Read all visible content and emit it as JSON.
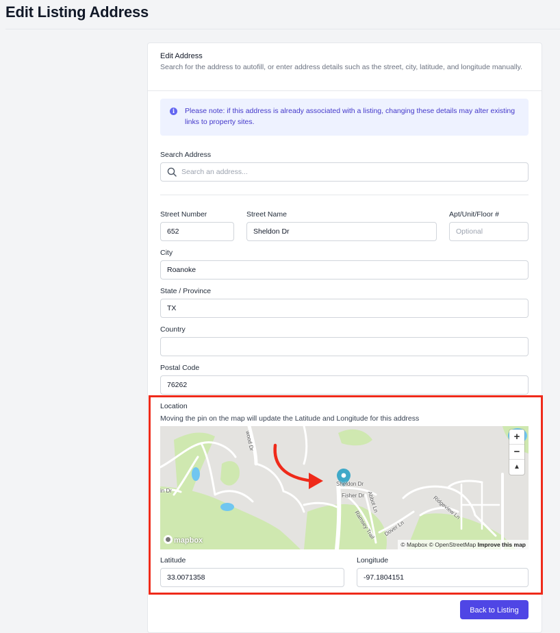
{
  "page": {
    "title": "Edit Listing Address"
  },
  "card": {
    "title": "Edit Address",
    "description": "Search for the address to autofill, or enter address details such as the street, city, latitude, and longitude manually."
  },
  "notice": {
    "icon": "info-icon",
    "text": "Please note: if this address is already associated with a listing, changing these details may alter existing links to property sites."
  },
  "search": {
    "label": "Search Address",
    "placeholder": "Search an address...",
    "icon": "search-icon"
  },
  "fields": {
    "street_number": {
      "label": "Street Number",
      "value": "652"
    },
    "street_name": {
      "label": "Street Name",
      "value": "Sheldon Dr"
    },
    "apt": {
      "label": "Apt/Unit/Floor #",
      "value": "",
      "placeholder": "Optional"
    },
    "city": {
      "label": "City",
      "value": "Roanoke"
    },
    "state": {
      "label": "State / Province",
      "value": "TX"
    },
    "country": {
      "label": "Country",
      "value": ""
    },
    "postal": {
      "label": "Postal Code",
      "value": "76262"
    }
  },
  "location": {
    "label": "Location",
    "hint": "Moving the pin on the map will update the Latitude and Longitude for this address"
  },
  "map": {
    "street_labels": [
      "wood Dr",
      "in Dr",
      "Sheldon Dr",
      "Fisher Dr",
      "Abbot Ln",
      "Ramsey Trail",
      "Dover Ln",
      "Ridgeview Ln"
    ],
    "controls": {
      "zoom_in": "+",
      "zoom_out": "−",
      "compass": "▲"
    },
    "logo": "mapbox",
    "attribution": "© Mapbox © OpenStreetMap",
    "improve": "Improve this map",
    "colors": {
      "land": "#e4e3e0",
      "park": "#cfe8b0",
      "water": "#70c6f0",
      "road": "#ffffff",
      "pin": "#3fa9c8",
      "arrow": "#ef2a1a"
    }
  },
  "coords": {
    "latitude": {
      "label": "Latitude",
      "value": "33.0071358"
    },
    "longitude": {
      "label": "Longitude",
      "value": "-97.1804151"
    }
  },
  "actions": {
    "back": "Back to Listing"
  },
  "highlight": {
    "color": "#ef2a1a"
  }
}
